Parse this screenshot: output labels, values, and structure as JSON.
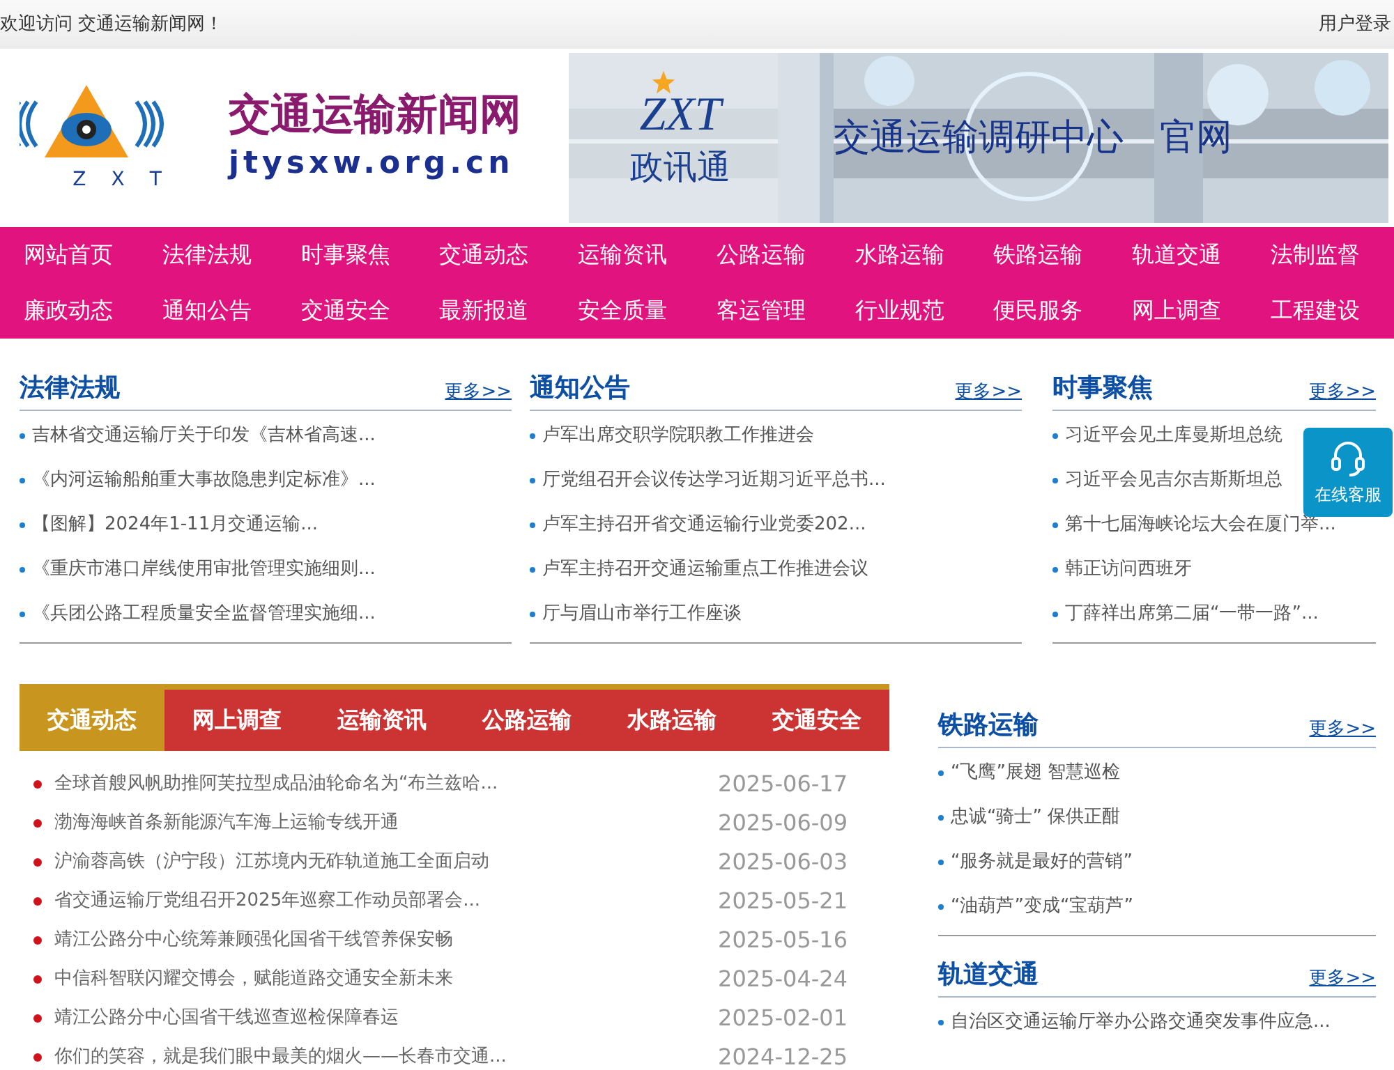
{
  "top_bar": {
    "welcome": "欢迎访问 交通运输新闻网！",
    "login": "用户登录"
  },
  "logo": {
    "letters": [
      "Z",
      "X",
      "T"
    ],
    "name": "交通运输新闻网",
    "domain": "jtysxw.org.cn"
  },
  "banner": {
    "brand": "ZXT",
    "brand_name": "政讯通",
    "title": "交通运输调研中心",
    "suffix": "官网"
  },
  "nav": [
    [
      "网站首页",
      "法律法规",
      "时事聚焦",
      "交通动态",
      "运输资讯",
      "公路运输",
      "水路运输",
      "铁路运输",
      "轨道交通",
      "法制监督"
    ],
    [
      "廉政动态",
      "通知公告",
      "交通安全",
      "最新报道",
      "安全质量",
      "客运管理",
      "行业规范",
      "便民服务",
      "网上调查",
      "工程建设"
    ]
  ],
  "sections": [
    {
      "title": "法律法规",
      "more": "更多>>",
      "items": [
        "吉林省交通运输厅关于印发《吉林省高速...",
        "《内河运输船舶重大事故隐患判定标准》...",
        "【图解】2024年1-11月交通运输...",
        "《重庆市港口岸线使用审批管理实施细则...",
        "《兵团公路工程质量安全监督管理实施细..."
      ]
    },
    {
      "title": "通知公告",
      "more": "更多>>",
      "items": [
        "卢军出席交职学院职教工作推进会",
        "厅党组召开会议传达学习近期习近平总书...",
        "卢军主持召开省交通运输行业党委202...",
        "卢军主持召开交通运输重点工作推进会议",
        "厅与眉山市举行工作座谈"
      ]
    },
    {
      "title": "时事聚焦",
      "more": "更多>>",
      "items": [
        "习近平会见土库曼斯坦总统",
        "习近平会见吉尔吉斯斯坦总",
        "第十七届海峡论坛大会在厦门举...",
        "韩正访问西班牙",
        "丁薛祥出席第二届“一带一路”..."
      ]
    }
  ],
  "service": {
    "label": "在线客服"
  },
  "news_tabs": [
    {
      "label": "交通动态",
      "selected": true
    },
    {
      "label": "网上调查",
      "selected": false
    },
    {
      "label": "运输资讯",
      "selected": false
    },
    {
      "label": "公路运输",
      "selected": false
    },
    {
      "label": "水路运输",
      "selected": false
    },
    {
      "label": "交通安全",
      "selected": false
    }
  ],
  "news": [
    {
      "title": "全球首艘风帆助推阿芙拉型成品油轮命名为“布兰兹哈...",
      "date": "2025-06-17"
    },
    {
      "title": "渤海海峡首条新能源汽车海上运输专线开通",
      "date": "2025-06-09"
    },
    {
      "title": "沪渝蓉高铁（沪宁段）江苏境内无砟轨道施工全面启动",
      "date": "2025-06-03"
    },
    {
      "title": "省交通运输厅党组召开2025年巡察工作动员部署会...",
      "date": "2025-05-21"
    },
    {
      "title": "靖江公路分中心统筹兼顾强化国省干线管养保安畅",
      "date": "2025-05-16"
    },
    {
      "title": "中信科智联闪耀交博会，赋能道路交通安全新未来",
      "date": "2025-04-24"
    },
    {
      "title": "靖江公路分中心国省干线巡查巡检保障春运",
      "date": "2025-02-01"
    },
    {
      "title": "你们的笑容，就是我们眼中最美的烟火——长春市交通...",
      "date": "2024-12-25"
    }
  ],
  "side_sections": [
    {
      "title": "铁路运输",
      "more": "更多>>",
      "items": [
        "“飞鹰”展翅 智慧巡检",
        "忠诚“骑士” 保供正酣",
        "“服务就是最好的营销”",
        "“油葫芦”变成“宝葫芦”"
      ]
    },
    {
      "title": "轨道交通",
      "more": "更多>>",
      "items": [
        "自治区交通运输厅举办公路交通突发事件应急..."
      ]
    }
  ]
}
